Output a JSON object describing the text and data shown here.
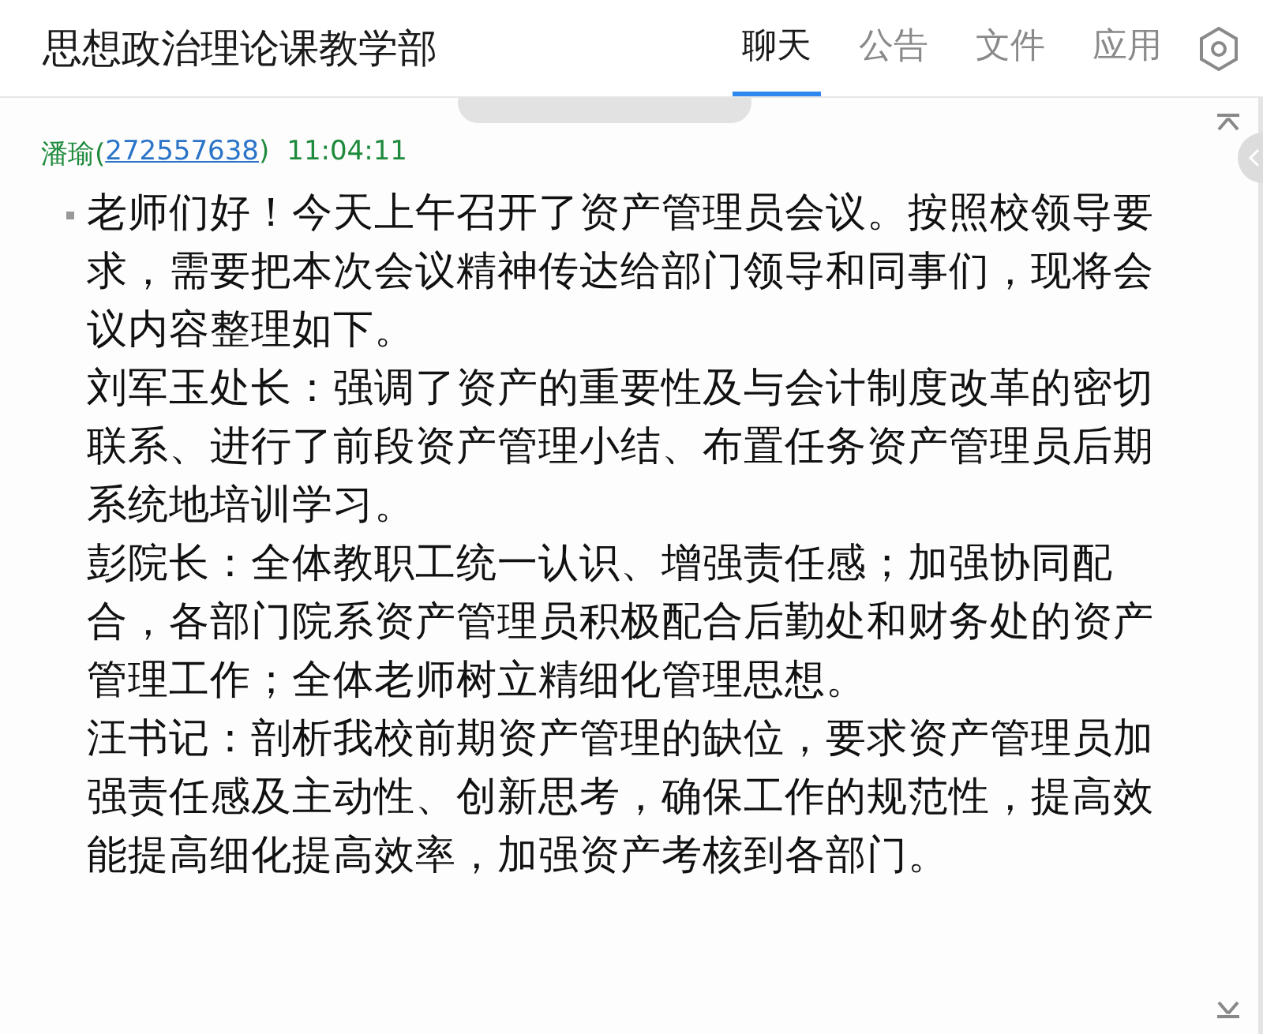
{
  "window": {
    "title": "思想政治理论课教学部"
  },
  "tabs": [
    {
      "label": "聊天",
      "selected": true
    },
    {
      "label": "公告",
      "selected": false
    },
    {
      "label": "文件",
      "selected": false
    },
    {
      "label": "应用",
      "selected": false
    }
  ],
  "message": {
    "sender": "潘瑜",
    "open_paren": "(",
    "sender_id": "272557638",
    "close_paren": ")",
    "time": "11:04:11",
    "paragraphs": [
      "老师们好！今天上午召开了资产管理员会议。按照校领导要求，需要把本次会议精神传达给部门领导和同事们，现将会议内容整理如下。",
      "刘军玉处长：强调了资产的重要性及与会计制度改革的密切联系、进行了前段资产管理小结、布置任务资产管理员后期系统地培训学习。",
      "彭院长：全体教职工统一认识、增强责任感；加强协同配合，各部门院系资产管理员积极配合后勤处和财务处的资产管理工作；全体老师树立精细化管理思想。",
      "汪书记：剖析我校前期资产管理的缺位，要求资产管理员加强责任感及主动性、创新思考，确保工作的规范性，提高效能提高细化提高效率，加强资产考核到各部门。"
    ]
  }
}
